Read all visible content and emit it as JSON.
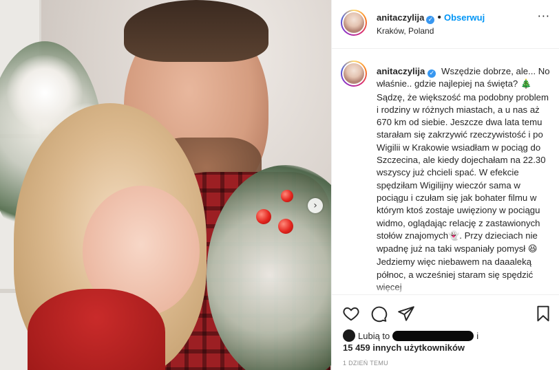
{
  "post": {
    "username": "anitaczylija",
    "location": "Kraków, Poland",
    "follow_label": "Obserwuj",
    "separator": "•",
    "more_label": "···",
    "carousel_next": "›"
  },
  "caption": {
    "username": "anitaczylija",
    "text_1": "Wszędzie dobrze, ale... No właśnie.. gdzie najlepiej na święta?",
    "emoji_tree": "🎄",
    "text_2": "Sądzę, że większość ma podobny problem i rodziny w różnych miastach, a u nas aż 670 km od siebie. Jeszcze dwa lata temu starałam się zakrzywić rzeczywistość i po Wigilii w Krakowie wsiadłam w pociąg do Szczecina, ale kiedy dojechałam na 22.30 wszyscy już chcieli spać. W efekcie spędziłam Wigilijny wieczór sama w pociągu i czułam się jak bohater filmu w którym ktoś zostaje uwięziony w pociągu widmo, oglądając relację z zastawionych stołów znajomych",
    "emoji_ghost": "👻",
    "text_3": ". Przy dzieciach nie wpadnę już na taki wspaniały pomysł",
    "emoji_grin": "😆",
    "text_4": "Jedziemy więc niebawem na daaaleką północ, a wcześniej staram się spędzić więcej"
  },
  "likes": {
    "prefix": "Lubią to",
    "suffix": "i",
    "count_line": "15 459 innych użytkowników"
  },
  "timestamp": "1 DZIEŃ TEMU",
  "icons": [
    "heart-icon",
    "comment-icon",
    "share-icon",
    "bookmark-icon",
    "verified-icon",
    "more-icon",
    "chevron-right-icon"
  ],
  "colors": {
    "link_blue": "#0095f6",
    "verified_blue": "#3897f0",
    "text": "#262626",
    "muted": "#8e8e8e",
    "border": "#efefef"
  }
}
